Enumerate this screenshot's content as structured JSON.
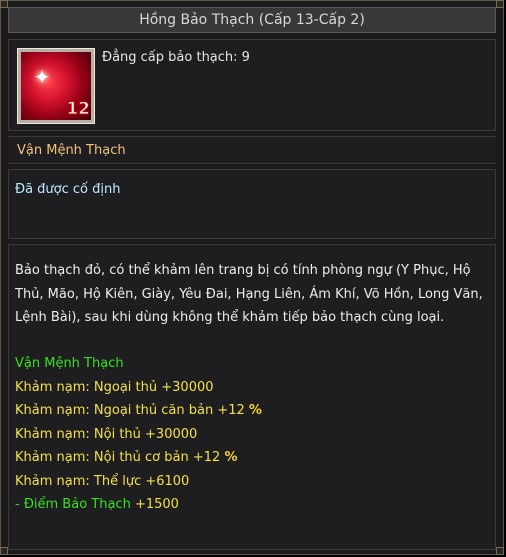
{
  "title": "Hồng Bảo Thạch (Cấp 13-Cấp 2)",
  "gem": {
    "icon": "red-gem-icon",
    "badge": "12",
    "level_text": "Đẳng cấp bảo thạch: 9"
  },
  "name_label": "Vận Mệnh Thạch",
  "status": "Đã được cố định",
  "description": "Bảo thạch đỏ, có thể khảm lên trang bị có tính phòng ngự (Y Phục, Hộ Thủ, Mão, Hộ Kiên, Giày, Yêu Đai, Hạng Liên, Ám Khí, Võ Hồn, Long Văn, Lệnh Bài), sau khi dùng không thể khảm tiếp bảo thạch cùng loại.",
  "set_name": "Vận Mệnh Thạch",
  "attributes": [
    {
      "text": "Khảm nạm: Ngoại thủ +30000",
      "suffix": ""
    },
    {
      "text": "Khảm nạm: Ngoại thủ căn bản +12",
      "suffix": "%"
    },
    {
      "text": "Khảm nạm: Nội thủ +30000",
      "suffix": ""
    },
    {
      "text": "Khảm nạm: Nội thủ cơ bản +12",
      "suffix": "%"
    },
    {
      "text": "Khảm nạm: Thể lực +6100",
      "suffix": ""
    }
  ],
  "score": {
    "prefix": "- Điểm Bảo Thạch ",
    "value": "+1500"
  },
  "colors": {
    "title_text": "#d8d8d8",
    "name_label": "#f2c37a",
    "status": "#bde8ff",
    "green": "#37e11f",
    "yellow": "#f3e04a"
  }
}
